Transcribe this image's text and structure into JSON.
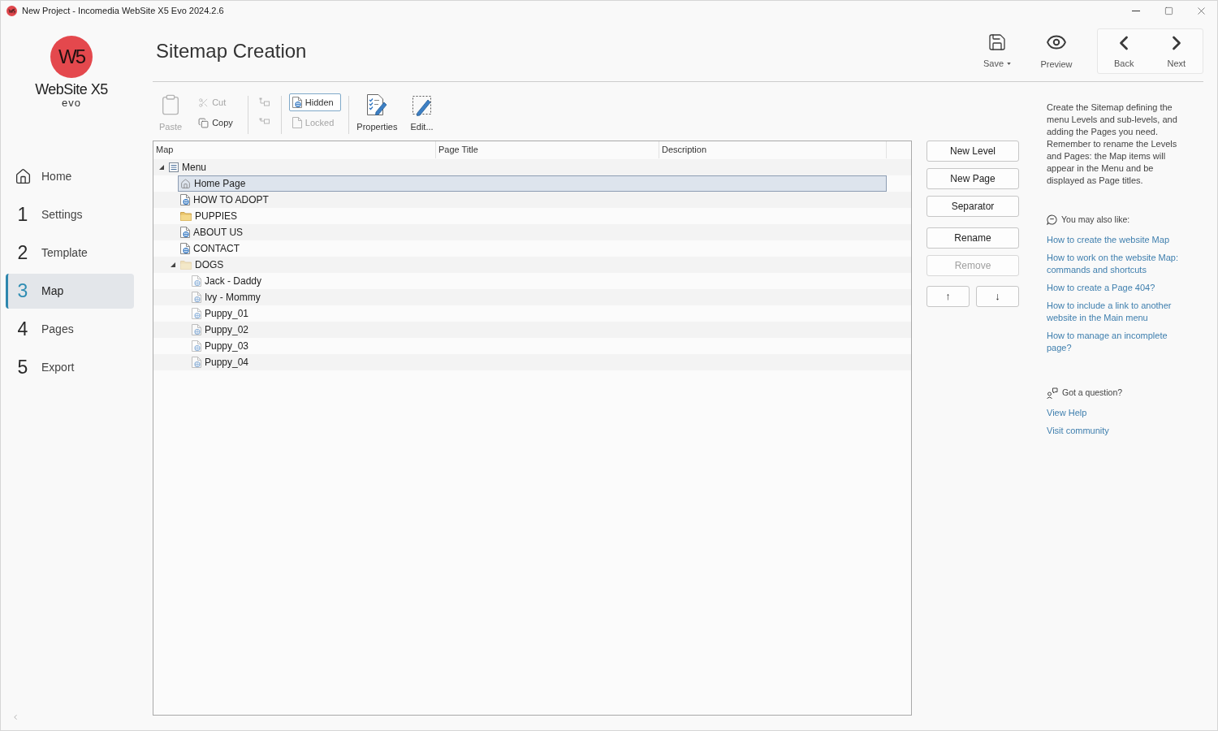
{
  "window": {
    "title": "New Project - Incomedia WebSite X5 Evo 2024.2.6"
  },
  "logo": {
    "mark": "W5",
    "name": "WebSite X5",
    "edition": "evo"
  },
  "sidebar": {
    "items": [
      {
        "kind": "home",
        "label": "Home",
        "selected": false
      },
      {
        "kind": "step",
        "number": "1",
        "label": "Settings",
        "selected": false
      },
      {
        "kind": "step",
        "number": "2",
        "label": "Template",
        "selected": false
      },
      {
        "kind": "step",
        "number": "3",
        "label": "Map",
        "selected": true
      },
      {
        "kind": "step",
        "number": "4",
        "label": "Pages",
        "selected": false
      },
      {
        "kind": "step",
        "number": "5",
        "label": "Export",
        "selected": false
      }
    ]
  },
  "header": {
    "title": "Sitemap Creation",
    "actions": [
      {
        "kind": "save",
        "label": "Save",
        "dropdown": true
      },
      {
        "kind": "preview",
        "label": "Preview",
        "dropdown": false
      }
    ],
    "navigation": [
      {
        "kind": "back",
        "label": "Back"
      },
      {
        "kind": "next",
        "label": "Next"
      }
    ]
  },
  "toolbar": {
    "sections": [
      {
        "columns": [
          {
            "kind": "large",
            "buttons": [
              {
                "kind": "paste",
                "label": "Paste",
                "disabled": true
              }
            ]
          },
          {
            "kind": "stack",
            "buttons": [
              {
                "kind": "cut",
                "label": "Cut",
                "disabled": true
              },
              {
                "kind": "copy",
                "label": "Copy",
                "disabled": false
              }
            ]
          }
        ]
      },
      {
        "columns": [
          {
            "kind": "stack",
            "buttons": [
              {
                "kind": "move_in",
                "disabled": true
              },
              {
                "kind": "move_out",
                "disabled": true
              }
            ]
          }
        ]
      },
      {
        "columns": [
          {
            "kind": "stack",
            "buttons": [
              {
                "kind": "hidden",
                "label": "Hidden",
                "disabled": false,
                "on": true
              },
              {
                "kind": "locked",
                "label": "Locked",
                "disabled": true,
                "on": false
              }
            ]
          }
        ]
      },
      {
        "columns": [
          {
            "kind": "large",
            "buttons": [
              {
                "kind": "properties",
                "label": "Properties",
                "disabled": false
              },
              {
                "kind": "edit",
                "label": "Edit...",
                "disabled": false
              }
            ]
          }
        ]
      }
    ]
  },
  "map": {
    "columns": [
      "Map",
      "Page Title",
      "Description"
    ],
    "tree": {
      "kind": "menu",
      "label": "Menu",
      "selected": false,
      "hidden": false,
      "expanded": true,
      "children": [
        {
          "kind": "home",
          "label": "Home Page",
          "selected": true,
          "hidden": false
        },
        {
          "kind": "page",
          "label": "HOW TO ADOPT",
          "selected": false,
          "hidden": false
        },
        {
          "kind": "folder",
          "label": "PUPPIES",
          "selected": false,
          "hidden": false
        },
        {
          "kind": "page",
          "label": "ABOUT US",
          "selected": false,
          "hidden": false
        },
        {
          "kind": "page",
          "label": "CONTACT",
          "selected": false,
          "hidden": false
        },
        {
          "kind": "folder",
          "label": "DOGS",
          "selected": false,
          "hidden": true,
          "expanded": true,
          "children": [
            {
              "kind": "page",
              "label": "Jack - Daddy",
              "selected": false,
              "hidden": true
            },
            {
              "kind": "page",
              "label": "Ivy - Mommy",
              "selected": false,
              "hidden": true
            },
            {
              "kind": "page",
              "label": "Puppy_01",
              "selected": false,
              "hidden": true
            },
            {
              "kind": "page",
              "label": "Puppy_02",
              "selected": false,
              "hidden": true
            },
            {
              "kind": "page",
              "label": "Puppy_03",
              "selected": false,
              "hidden": true
            },
            {
              "kind": "page",
              "label": "Puppy_04",
              "selected": false,
              "hidden": true
            }
          ]
        }
      ]
    }
  },
  "map_buttons": {
    "groups": [
      {
        "buttons": [
          {
            "label": "New Level",
            "disabled": false
          },
          {
            "label": "New Page",
            "disabled": false
          },
          {
            "label": "Separator",
            "disabled": false
          }
        ]
      },
      {
        "buttons": [
          {
            "label": "Rename",
            "disabled": false
          },
          {
            "label": "Remove",
            "disabled": true
          }
        ]
      }
    ],
    "move": [
      {
        "label": "↑",
        "disabled": false
      },
      {
        "label": "↓",
        "disabled": false
      }
    ]
  },
  "help": {
    "intro": "Create the Sitemap defining the menu Levels and sub-levels, and adding the Pages you need. Remember to rename the Levels and Pages: the Map items will appear in the Menu and be displayed as Page titles.",
    "related": {
      "title": "You may also like:",
      "links": [
        "How to create the website Map",
        "How to work on the website Map: commands and shortcuts",
        "How to create a Page 404?",
        "How to include a link to another website in the Main menu",
        "How to manage an incomplete page?"
      ]
    },
    "support": {
      "title": "Got a question?",
      "links": [
        "View Help",
        "Visit community"
      ]
    }
  }
}
